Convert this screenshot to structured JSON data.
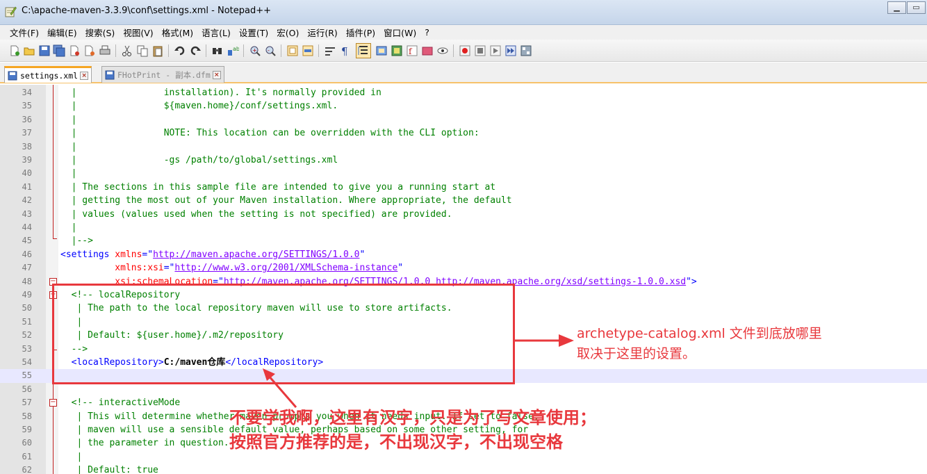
{
  "window": {
    "title": "C:\\apache-maven-3.3.9\\conf\\settings.xml - Notepad++"
  },
  "menu": [
    "文件(F)",
    "编辑(E)",
    "搜索(S)",
    "视图(V)",
    "格式(M)",
    "语言(L)",
    "设置(T)",
    "宏(O)",
    "运行(R)",
    "插件(P)",
    "窗口(W)",
    "?"
  ],
  "tabs": [
    {
      "label": "settings.xml",
      "active": true
    },
    {
      "label": "FHotPrint - 副本.dfm",
      "active": false
    }
  ],
  "colors": {
    "comment": "#008000",
    "tag": "#0000ff",
    "attribute": "#ff0000",
    "value": "#8000ff",
    "annotation": "#e8383d",
    "tab_accent": "#f5a623"
  },
  "editor": {
    "lines": [
      {
        "n": "34",
        "segs": [
          [
            "c-com",
            "  |                installation). It's normally provided in"
          ]
        ]
      },
      {
        "n": "35",
        "segs": [
          [
            "c-com",
            "  |                ${maven.home}/conf/settings.xml."
          ]
        ]
      },
      {
        "n": "36",
        "segs": [
          [
            "c-com",
            "  |"
          ]
        ]
      },
      {
        "n": "37",
        "segs": [
          [
            "c-com",
            "  |                NOTE: This location can be overridden with the CLI option:"
          ]
        ]
      },
      {
        "n": "38",
        "segs": [
          [
            "c-com",
            "  |"
          ]
        ]
      },
      {
        "n": "39",
        "segs": [
          [
            "c-com",
            "  |                -gs /path/to/global/settings.xml"
          ]
        ]
      },
      {
        "n": "40",
        "segs": [
          [
            "c-com",
            "  |"
          ]
        ]
      },
      {
        "n": "41",
        "segs": [
          [
            "c-com",
            "  | The sections in this sample file are intended to give you a running start at"
          ]
        ]
      },
      {
        "n": "42",
        "segs": [
          [
            "c-com",
            "  | getting the most out of your Maven installation. Where appropriate, the default"
          ]
        ]
      },
      {
        "n": "43",
        "segs": [
          [
            "c-com",
            "  | values (values used when the setting is not specified) are provided."
          ]
        ]
      },
      {
        "n": "44",
        "segs": [
          [
            "c-com",
            "  |"
          ]
        ]
      },
      {
        "n": "45",
        "segs": [
          [
            "c-com",
            "  |-->"
          ]
        ]
      },
      {
        "n": "46",
        "segs": [
          [
            "c-tag",
            "<settings "
          ],
          [
            "c-attr",
            "xmlns"
          ],
          [
            "c-tag",
            "=\""
          ],
          [
            "c-val",
            "http://maven.apache.org/SETTINGS/1.0.0"
          ],
          [
            "c-tag",
            "\""
          ]
        ]
      },
      {
        "n": "47",
        "segs": [
          [
            "c-tag",
            "          "
          ],
          [
            "c-attr",
            "xmlns:xsi"
          ],
          [
            "c-tag",
            "=\""
          ],
          [
            "c-val",
            "http://www.w3.org/2001/XMLSchema-instance"
          ],
          [
            "c-tag",
            "\""
          ]
        ]
      },
      {
        "n": "48",
        "segs": [
          [
            "c-tag",
            "          "
          ],
          [
            "c-attr",
            "xsi:schemaLocation"
          ],
          [
            "c-tag",
            "=\""
          ],
          [
            "c-val",
            "http://maven.apache.org/SETTINGS/1.0.0 http://maven.apache.org/xsd/settings-1.0.0.xsd"
          ],
          [
            "c-tag",
            "\">"
          ]
        ]
      },
      {
        "n": "49",
        "segs": [
          [
            "c-com",
            "  <!-- localRepository"
          ]
        ]
      },
      {
        "n": "50",
        "segs": [
          [
            "c-com",
            "   | The path to the local repository maven will use to store artifacts."
          ]
        ]
      },
      {
        "n": "51",
        "segs": [
          [
            "c-com",
            "   |"
          ]
        ]
      },
      {
        "n": "52",
        "segs": [
          [
            "c-com",
            "   | Default: ${user.home}/.m2/repository"
          ]
        ]
      },
      {
        "n": "53",
        "segs": [
          [
            "c-com",
            "  -->"
          ]
        ]
      },
      {
        "n": "54",
        "segs": [
          [
            "c-tag",
            "  <localRepository>"
          ],
          [
            "c-txt",
            "C:/maven仓库"
          ],
          [
            "c-tag",
            "</localRepository>"
          ]
        ]
      },
      {
        "n": "55",
        "segs": [],
        "caret": true
      },
      {
        "n": "56",
        "segs": []
      },
      {
        "n": "57",
        "segs": [
          [
            "c-com",
            "  <!-- interactiveMode"
          ]
        ]
      },
      {
        "n": "58",
        "segs": [
          [
            "c-com",
            "   | This will determine whether maven prompts you when it needs input. If set to false,"
          ]
        ]
      },
      {
        "n": "59",
        "segs": [
          [
            "c-com",
            "   | maven will use a sensible default value, perhaps based on some other setting, for"
          ]
        ]
      },
      {
        "n": "60",
        "segs": [
          [
            "c-com",
            "   | the parameter in question."
          ]
        ]
      },
      {
        "n": "61",
        "segs": [
          [
            "c-com",
            "   |"
          ]
        ]
      },
      {
        "n": "62",
        "segs": [
          [
            "c-com",
            "   | Default: true"
          ]
        ]
      }
    ]
  },
  "annotations": {
    "right_line1": "archetype-catalog.xml 文件到底放哪里",
    "right_line2": "取决于这里的设置。",
    "bottom_line1": "不要学我啊，这里有汉字，只是为了写文章使用；",
    "bottom_line2": "按照官方推荐的是，不出现汉字，不出现空格"
  }
}
